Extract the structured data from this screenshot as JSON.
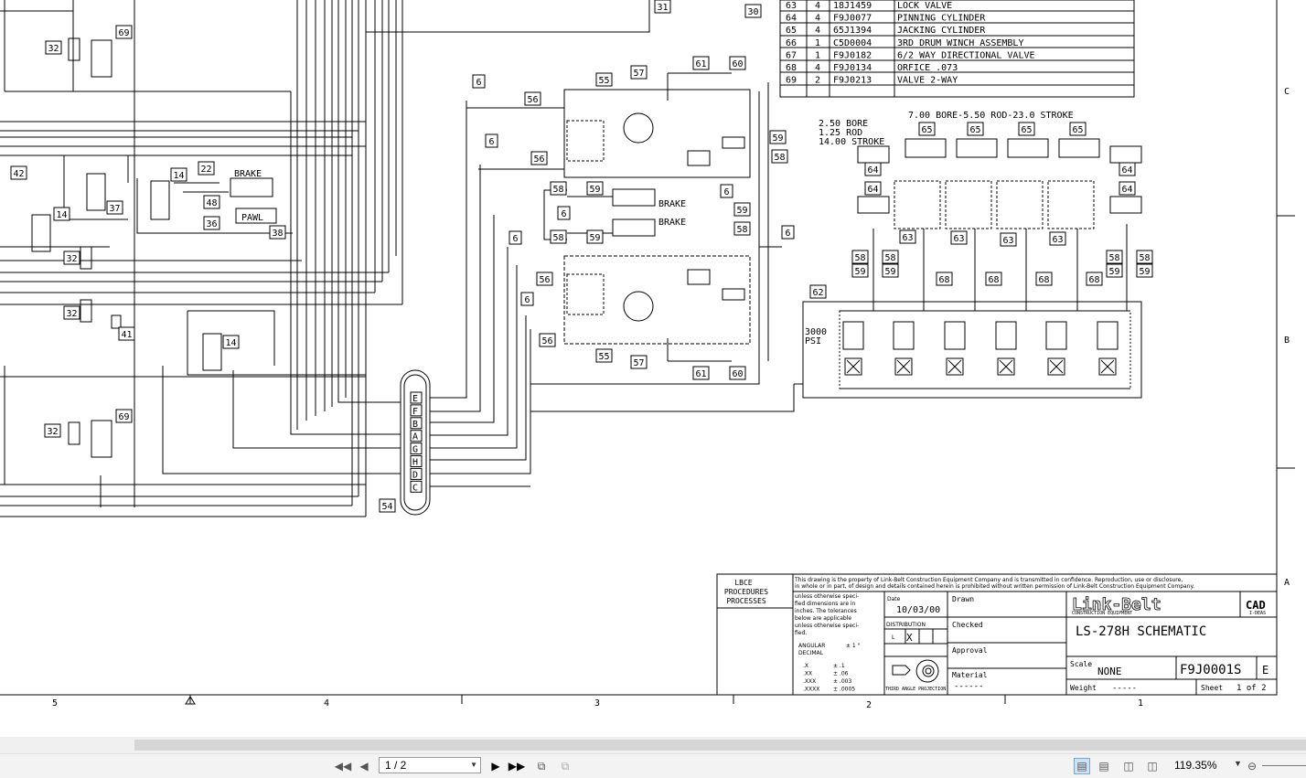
{
  "parts_list": [
    {
      "item": "63",
      "qty": "4",
      "part": "18J1459",
      "desc": "LOCK VALVE"
    },
    {
      "item": "64",
      "qty": "4",
      "part": "F9J0077",
      "desc": "PINNING CYLINDER"
    },
    {
      "item": "65",
      "qty": "4",
      "part": "65J1394",
      "desc": "JACKING CYLINDER"
    },
    {
      "item": "66",
      "qty": "1",
      "part": "C5D0004",
      "desc": "3RD DRUM WINCH ASSEMBLY"
    },
    {
      "item": "67",
      "qty": "1",
      "part": "F9J0182",
      "desc": "6/2 WAY DIRECTIONAL VALVE"
    },
    {
      "item": "68",
      "qty": "4",
      "part": "F9J0134",
      "desc": "ORFICE .073"
    },
    {
      "item": "69",
      "qty": "2",
      "part": "F9J0213",
      "desc": "VALVE 2-WAY"
    }
  ],
  "schematic": {
    "cyl_small": [
      "2.50 BORE",
      "1.25 ROD",
      "14.00 STROKE"
    ],
    "cyl_large": "7.00 BORE-5.50 ROD-23.0 STROKE",
    "pressure": [
      "3000",
      "PSI"
    ],
    "brake": "BRAKE",
    "pawl": "PAWL",
    "swivel_ports": [
      "E",
      "F",
      "B",
      "A",
      "G",
      "H",
      "D",
      "C"
    ]
  },
  "title_block": {
    "lbce": [
      "LBCE",
      "PROCEDURES",
      "PROCESSES"
    ],
    "notice_1": "This drawing is the property of Link-Belt Construction Equipment Company and is transmitted in confidence. Reproduction, use or disclosure,",
    "notice_2": "in whole or in part, of design and details contained herein is prohibited without written permission of Link-Belt Construction Equipment Company.",
    "tolerance_note": [
      "unless otherwise speci-",
      "fied dimensions are in",
      "inches. The tolerances",
      "below are applicable",
      "unless otherwise speci-",
      "fied."
    ],
    "angular": "ANGULAR",
    "decimal": "DECIMAL",
    "angular_tol": "± 1 °",
    "tolerances": [
      [
        ".X",
        "± .1"
      ],
      [
        ".XX",
        "± .06"
      ],
      [
        ".XXX",
        "± .003"
      ],
      [
        ".XXXX",
        "± .0005"
      ]
    ],
    "date_label": "Date",
    "date": "10/03/00",
    "distribution": "DISTRIBUTION",
    "dist_l": "L",
    "dist_x": "X",
    "projection": "THIRD ANGLE PROJECTION",
    "drawn": "Drawn",
    "checked": "Checked",
    "approval": "Approval",
    "material_label": "Material",
    "material": "------",
    "logo": "Link-Belt",
    "logo_sub": "CONSTRUCTION EQUIPMENT",
    "cad": "CAD",
    "cad_sub": "I-DEAS",
    "title": "LS-278H SCHEMATIC",
    "scale_label": "Scale",
    "scale": "NONE",
    "drawing_no": "F9J0001S",
    "rev": "E",
    "weight_label": "Weight",
    "weight": "-----",
    "sheet_label": "Sheet",
    "sheet": "1 of 2"
  },
  "border": {
    "zones_x": [
      "5",
      "4",
      "3",
      "2",
      "1"
    ],
    "zones_y": [
      "C",
      "B",
      "A"
    ]
  },
  "viewer": {
    "page_value": "1 / 2",
    "zoom": "119.35%"
  }
}
